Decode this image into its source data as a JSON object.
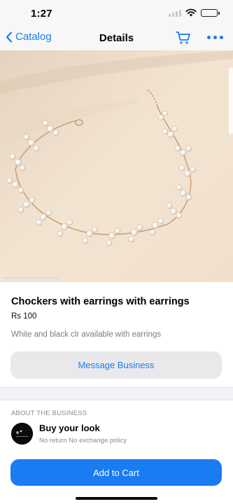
{
  "status": {
    "time": "1:27"
  },
  "nav": {
    "back_label": "Catalog",
    "title": "Details"
  },
  "product": {
    "title": "Chockers with earrings with earrings",
    "price": "Rs 100",
    "description": "White and black clr available with earrings",
    "message_button": "Message Business"
  },
  "business": {
    "section_label": "ABOUT THE BUSINESS",
    "name": "Buy your look",
    "subtitle": "No return No exchange policy"
  },
  "cart_button": "Add to Cart",
  "colors": {
    "accent": "#1a7cf3",
    "background_image": "#f2e2cf",
    "button_grey": "#e9e9eb"
  },
  "icons": [
    "chevron-left-icon",
    "cart-icon",
    "more-icon",
    "wifi-icon",
    "battery-icon",
    "signal-icon"
  ]
}
